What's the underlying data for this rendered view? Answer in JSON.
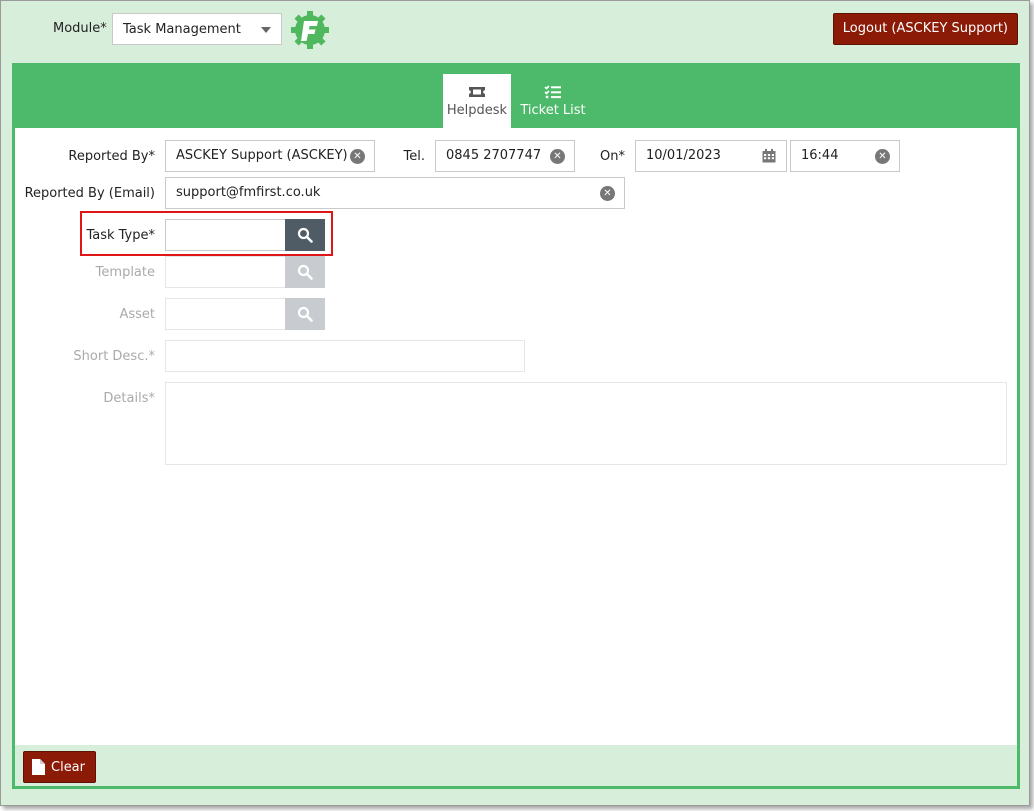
{
  "header": {
    "module_label": "Module*",
    "module_value": "Task Management",
    "logout_label": "Logout (ASCKEY Support)"
  },
  "tabs": [
    {
      "label": "Helpdesk",
      "icon": "ticket-icon",
      "active": true
    },
    {
      "label": "Ticket List",
      "icon": "checklist-icon",
      "active": false
    }
  ],
  "form": {
    "reported_by_label": "Reported By*",
    "reported_by_value": "ASCKEY Support (ASCKEY)",
    "tel_label": "Tel.",
    "tel_value": "0845 2707747",
    "on_label": "On*",
    "date_value": "10/01/2023",
    "time_value": "16:44",
    "email_label": "Reported By (Email)",
    "email_value": "support@fmfirst.co.uk",
    "task_type_label": "Task Type*",
    "task_type_value": "",
    "template_label": "Template",
    "template_value": "",
    "asset_label": "Asset",
    "asset_value": "",
    "short_desc_label": "Short Desc.*",
    "short_desc_value": "",
    "details_label": "Details*",
    "details_value": ""
  },
  "footer": {
    "clear_label": "Clear"
  },
  "colors": {
    "brand_green": "#4cba6a",
    "light_green": "#d7eedb",
    "button_red": "#8b1a06",
    "search_button": "#4f5c66",
    "highlight": "#e01515"
  }
}
